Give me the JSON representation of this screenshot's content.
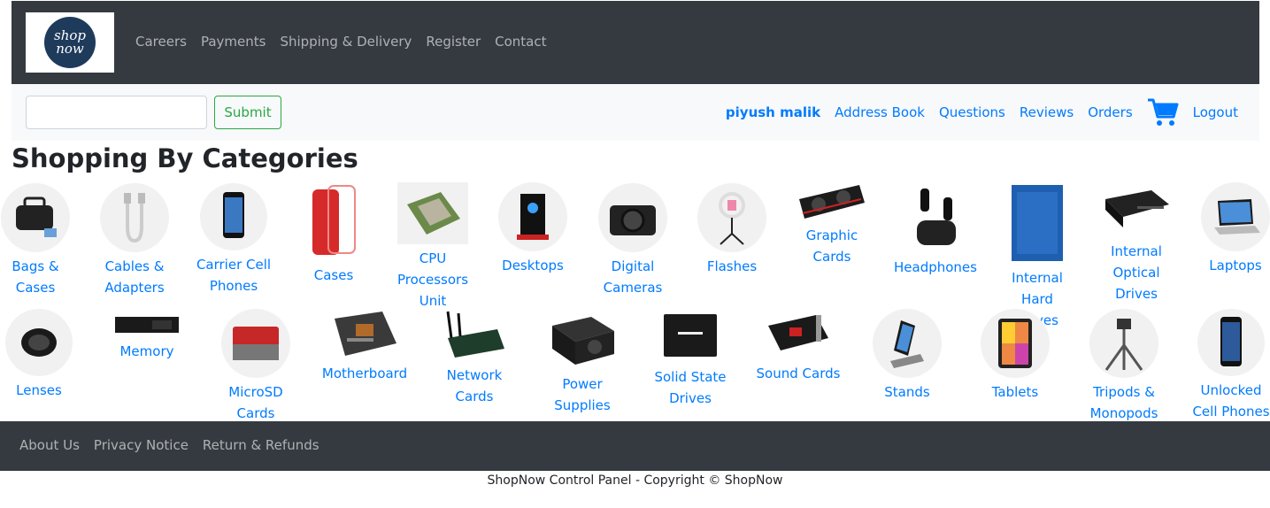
{
  "brand": {
    "logo_line1": "shop",
    "logo_line2": "now"
  },
  "topnav": {
    "links": [
      "Careers",
      "Payments",
      "Shipping & Delivery",
      "Register",
      "Contact"
    ]
  },
  "search": {
    "value": "",
    "placeholder": "",
    "submit_label": "Submit"
  },
  "user": {
    "name": "piyush malik",
    "links": [
      "Address Book",
      "Questions",
      "Reviews",
      "Orders"
    ],
    "cart_icon": "shopping-cart-icon",
    "logout_label": "Logout"
  },
  "page_title": "Shopping By Categories",
  "categories_row1": [
    {
      "name": "Bags & Cases"
    },
    {
      "name": "Cables & Adapters"
    },
    {
      "name": "Carrier Cell Phones"
    },
    {
      "name": "Cases"
    },
    {
      "name": "CPU Processors Unit"
    },
    {
      "name": "Desktops"
    },
    {
      "name": "Digital Cameras"
    },
    {
      "name": "Flashes"
    },
    {
      "name": "Graphic Cards"
    },
    {
      "name": "Headphones"
    },
    {
      "name": "Internal Hard Drives"
    },
    {
      "name": "Internal Optical Drives"
    },
    {
      "name": "Laptops"
    }
  ],
  "categories_row2": [
    {
      "name": "Lenses"
    },
    {
      "name": "Memory"
    },
    {
      "name": "MicroSD Cards"
    },
    {
      "name": "Motherboard"
    },
    {
      "name": "Network Cards"
    },
    {
      "name": "Power Supplies"
    },
    {
      "name": "Solid State Drives"
    },
    {
      "name": "Sound Cards"
    },
    {
      "name": "Stands"
    },
    {
      "name": "Tablets"
    },
    {
      "name": "Tripods & Monopods"
    },
    {
      "name": "Unlocked Cell Phones"
    }
  ],
  "footer": {
    "links": [
      "About Us",
      "Privacy Notice",
      "Return & Refunds"
    ],
    "copyright": "ShopNow Control Panel - Copyright © ShopNow"
  },
  "colors": {
    "nav_bg": "#343a40",
    "link": "#007bff",
    "success": "#28a745",
    "light_bg": "#f8f9fa"
  }
}
